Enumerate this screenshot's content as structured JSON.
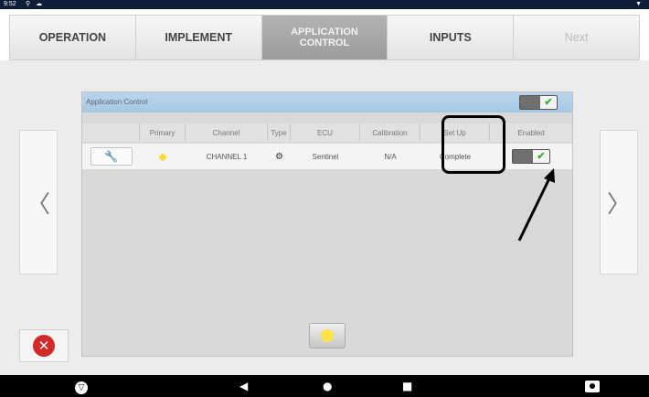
{
  "status_bar": {
    "time": "9:52",
    "icons": "⚲ ☁",
    "wifi_icon": "▼"
  },
  "tabs": [
    {
      "label": "OPERATION",
      "active": false
    },
    {
      "label": "IMPLEMENT",
      "active": false
    },
    {
      "label": "APPLICATION\nCONTROL",
      "active": true
    },
    {
      "label": "INPUTS",
      "active": false
    },
    {
      "label": "Next",
      "active": false,
      "disabled": true
    }
  ],
  "panel": {
    "title": "Application Control",
    "enabled": true,
    "columns": [
      "",
      "Primary",
      "Channel",
      "Type",
      "ECU",
      "Calibration",
      "Set Up",
      "Enabled"
    ],
    "rows": [
      {
        "action_icon": "wrench-icon",
        "primary": true,
        "channel": "CHANNEL 1",
        "type_icon": "circle-gear-icon",
        "ecu": "Sentinel",
        "calibration": "N/A",
        "setup": "Complete",
        "enabled": true
      }
    ]
  },
  "navigation": {
    "prev_glyph": "〈",
    "next_glyph": "〉"
  },
  "colors": {
    "accent_header": "#a6c7e4",
    "check_green": "#3cae2f",
    "cancel_red": "#d42a2a",
    "primary_yellow": "#ffd92e"
  }
}
